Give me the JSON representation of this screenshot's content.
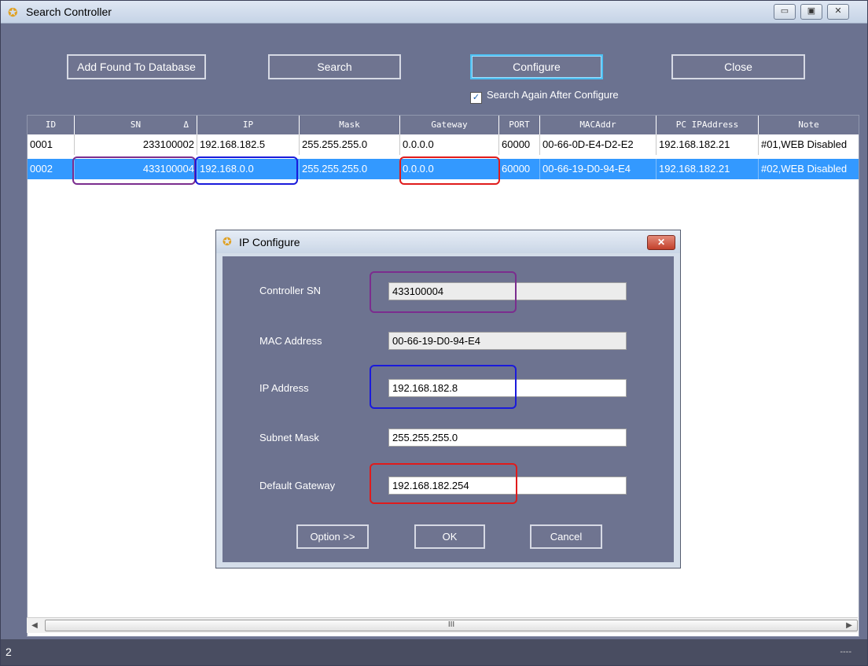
{
  "window": {
    "title": "Search Controller",
    "app_icon": "running-man-icon",
    "controls": [
      "minimize",
      "maximize",
      "close"
    ]
  },
  "toolbar": {
    "add_found": "Add Found To Database",
    "search": "Search",
    "configure": "Configure",
    "close": "Close",
    "search_again_label": "Search Again After Configure",
    "search_again_checked": true
  },
  "table": {
    "columns": [
      "ID",
      "SN",
      "IP",
      "Mask",
      "Gateway",
      "PORT",
      "MACAddr",
      "PC IPAddress",
      "Note"
    ],
    "sort_indicator": "Δ",
    "rows": [
      [
        "0001",
        "233100002",
        "192.168.182.5",
        "255.255.255.0",
        "0.0.0.0",
        "60000",
        "00-66-0D-E4-D2-E2",
        "192.168.182.21",
        "#01,WEB Disabled"
      ],
      [
        "0002",
        "433100004",
        "192.168.0.0",
        "255.255.255.0",
        "0.0.0.0",
        "60000",
        "00-66-19-D0-94-E4",
        "192.168.182.21",
        "#02,WEB Disabled"
      ]
    ],
    "selected_row": 1
  },
  "scrollbar": {
    "thumb_grip": "III"
  },
  "status": {
    "count": "2",
    "dots": "----"
  },
  "dialog": {
    "title": "IP Configure",
    "close_glyph": "✕",
    "fields": {
      "controller_sn": {
        "label": "Controller SN",
        "value": "433100004",
        "readonly": true
      },
      "mac_address": {
        "label": "MAC Address",
        "value": "00-66-19-D0-94-E4",
        "readonly": true
      },
      "ip_address": {
        "label": "IP Address",
        "value": "192.168.182.8"
      },
      "subnet_mask": {
        "label": "Subnet Mask",
        "value": "255.255.255.0"
      },
      "default_gateway": {
        "label": "Default Gateway",
        "value": "192.168.182.254"
      }
    },
    "buttons": {
      "option": "Option >>",
      "ok": "OK",
      "cancel": "Cancel"
    }
  },
  "highlights": {
    "sn": "#7b2d8e",
    "ip": "#1a1adb",
    "gateway": "#e01b1b"
  }
}
